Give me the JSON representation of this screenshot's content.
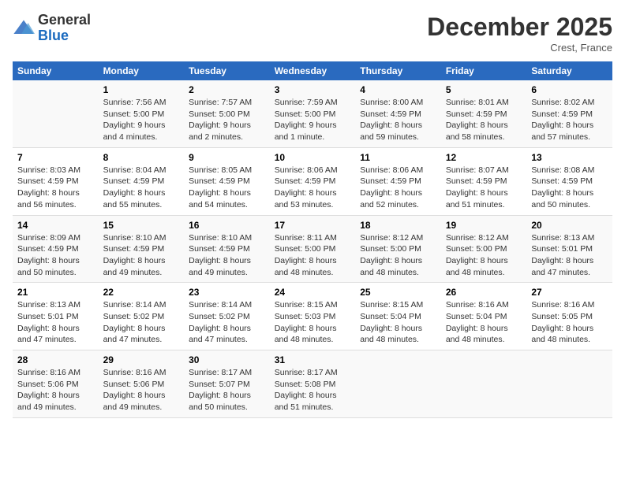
{
  "header": {
    "logo_general": "General",
    "logo_blue": "Blue",
    "month_title": "December 2025",
    "location": "Crest, France"
  },
  "days_of_week": [
    "Sunday",
    "Monday",
    "Tuesday",
    "Wednesday",
    "Thursday",
    "Friday",
    "Saturday"
  ],
  "weeks": [
    [
      {
        "day": "",
        "info": ""
      },
      {
        "day": "1",
        "info": "Sunrise: 7:56 AM\nSunset: 5:00 PM\nDaylight: 9 hours\nand 4 minutes."
      },
      {
        "day": "2",
        "info": "Sunrise: 7:57 AM\nSunset: 5:00 PM\nDaylight: 9 hours\nand 2 minutes."
      },
      {
        "day": "3",
        "info": "Sunrise: 7:59 AM\nSunset: 5:00 PM\nDaylight: 9 hours\nand 1 minute."
      },
      {
        "day": "4",
        "info": "Sunrise: 8:00 AM\nSunset: 4:59 PM\nDaylight: 8 hours\nand 59 minutes."
      },
      {
        "day": "5",
        "info": "Sunrise: 8:01 AM\nSunset: 4:59 PM\nDaylight: 8 hours\nand 58 minutes."
      },
      {
        "day": "6",
        "info": "Sunrise: 8:02 AM\nSunset: 4:59 PM\nDaylight: 8 hours\nand 57 minutes."
      }
    ],
    [
      {
        "day": "7",
        "info": "Sunrise: 8:03 AM\nSunset: 4:59 PM\nDaylight: 8 hours\nand 56 minutes."
      },
      {
        "day": "8",
        "info": "Sunrise: 8:04 AM\nSunset: 4:59 PM\nDaylight: 8 hours\nand 55 minutes."
      },
      {
        "day": "9",
        "info": "Sunrise: 8:05 AM\nSunset: 4:59 PM\nDaylight: 8 hours\nand 54 minutes."
      },
      {
        "day": "10",
        "info": "Sunrise: 8:06 AM\nSunset: 4:59 PM\nDaylight: 8 hours\nand 53 minutes."
      },
      {
        "day": "11",
        "info": "Sunrise: 8:06 AM\nSunset: 4:59 PM\nDaylight: 8 hours\nand 52 minutes."
      },
      {
        "day": "12",
        "info": "Sunrise: 8:07 AM\nSunset: 4:59 PM\nDaylight: 8 hours\nand 51 minutes."
      },
      {
        "day": "13",
        "info": "Sunrise: 8:08 AM\nSunset: 4:59 PM\nDaylight: 8 hours\nand 50 minutes."
      }
    ],
    [
      {
        "day": "14",
        "info": "Sunrise: 8:09 AM\nSunset: 4:59 PM\nDaylight: 8 hours\nand 50 minutes."
      },
      {
        "day": "15",
        "info": "Sunrise: 8:10 AM\nSunset: 4:59 PM\nDaylight: 8 hours\nand 49 minutes."
      },
      {
        "day": "16",
        "info": "Sunrise: 8:10 AM\nSunset: 4:59 PM\nDaylight: 8 hours\nand 49 minutes."
      },
      {
        "day": "17",
        "info": "Sunrise: 8:11 AM\nSunset: 5:00 PM\nDaylight: 8 hours\nand 48 minutes."
      },
      {
        "day": "18",
        "info": "Sunrise: 8:12 AM\nSunset: 5:00 PM\nDaylight: 8 hours\nand 48 minutes."
      },
      {
        "day": "19",
        "info": "Sunrise: 8:12 AM\nSunset: 5:00 PM\nDaylight: 8 hours\nand 48 minutes."
      },
      {
        "day": "20",
        "info": "Sunrise: 8:13 AM\nSunset: 5:01 PM\nDaylight: 8 hours\nand 47 minutes."
      }
    ],
    [
      {
        "day": "21",
        "info": "Sunrise: 8:13 AM\nSunset: 5:01 PM\nDaylight: 8 hours\nand 47 minutes."
      },
      {
        "day": "22",
        "info": "Sunrise: 8:14 AM\nSunset: 5:02 PM\nDaylight: 8 hours\nand 47 minutes."
      },
      {
        "day": "23",
        "info": "Sunrise: 8:14 AM\nSunset: 5:02 PM\nDaylight: 8 hours\nand 47 minutes."
      },
      {
        "day": "24",
        "info": "Sunrise: 8:15 AM\nSunset: 5:03 PM\nDaylight: 8 hours\nand 48 minutes."
      },
      {
        "day": "25",
        "info": "Sunrise: 8:15 AM\nSunset: 5:04 PM\nDaylight: 8 hours\nand 48 minutes."
      },
      {
        "day": "26",
        "info": "Sunrise: 8:16 AM\nSunset: 5:04 PM\nDaylight: 8 hours\nand 48 minutes."
      },
      {
        "day": "27",
        "info": "Sunrise: 8:16 AM\nSunset: 5:05 PM\nDaylight: 8 hours\nand 48 minutes."
      }
    ],
    [
      {
        "day": "28",
        "info": "Sunrise: 8:16 AM\nSunset: 5:06 PM\nDaylight: 8 hours\nand 49 minutes."
      },
      {
        "day": "29",
        "info": "Sunrise: 8:16 AM\nSunset: 5:06 PM\nDaylight: 8 hours\nand 49 minutes."
      },
      {
        "day": "30",
        "info": "Sunrise: 8:17 AM\nSunset: 5:07 PM\nDaylight: 8 hours\nand 50 minutes."
      },
      {
        "day": "31",
        "info": "Sunrise: 8:17 AM\nSunset: 5:08 PM\nDaylight: 8 hours\nand 51 minutes."
      },
      {
        "day": "",
        "info": ""
      },
      {
        "day": "",
        "info": ""
      },
      {
        "day": "",
        "info": ""
      }
    ]
  ]
}
